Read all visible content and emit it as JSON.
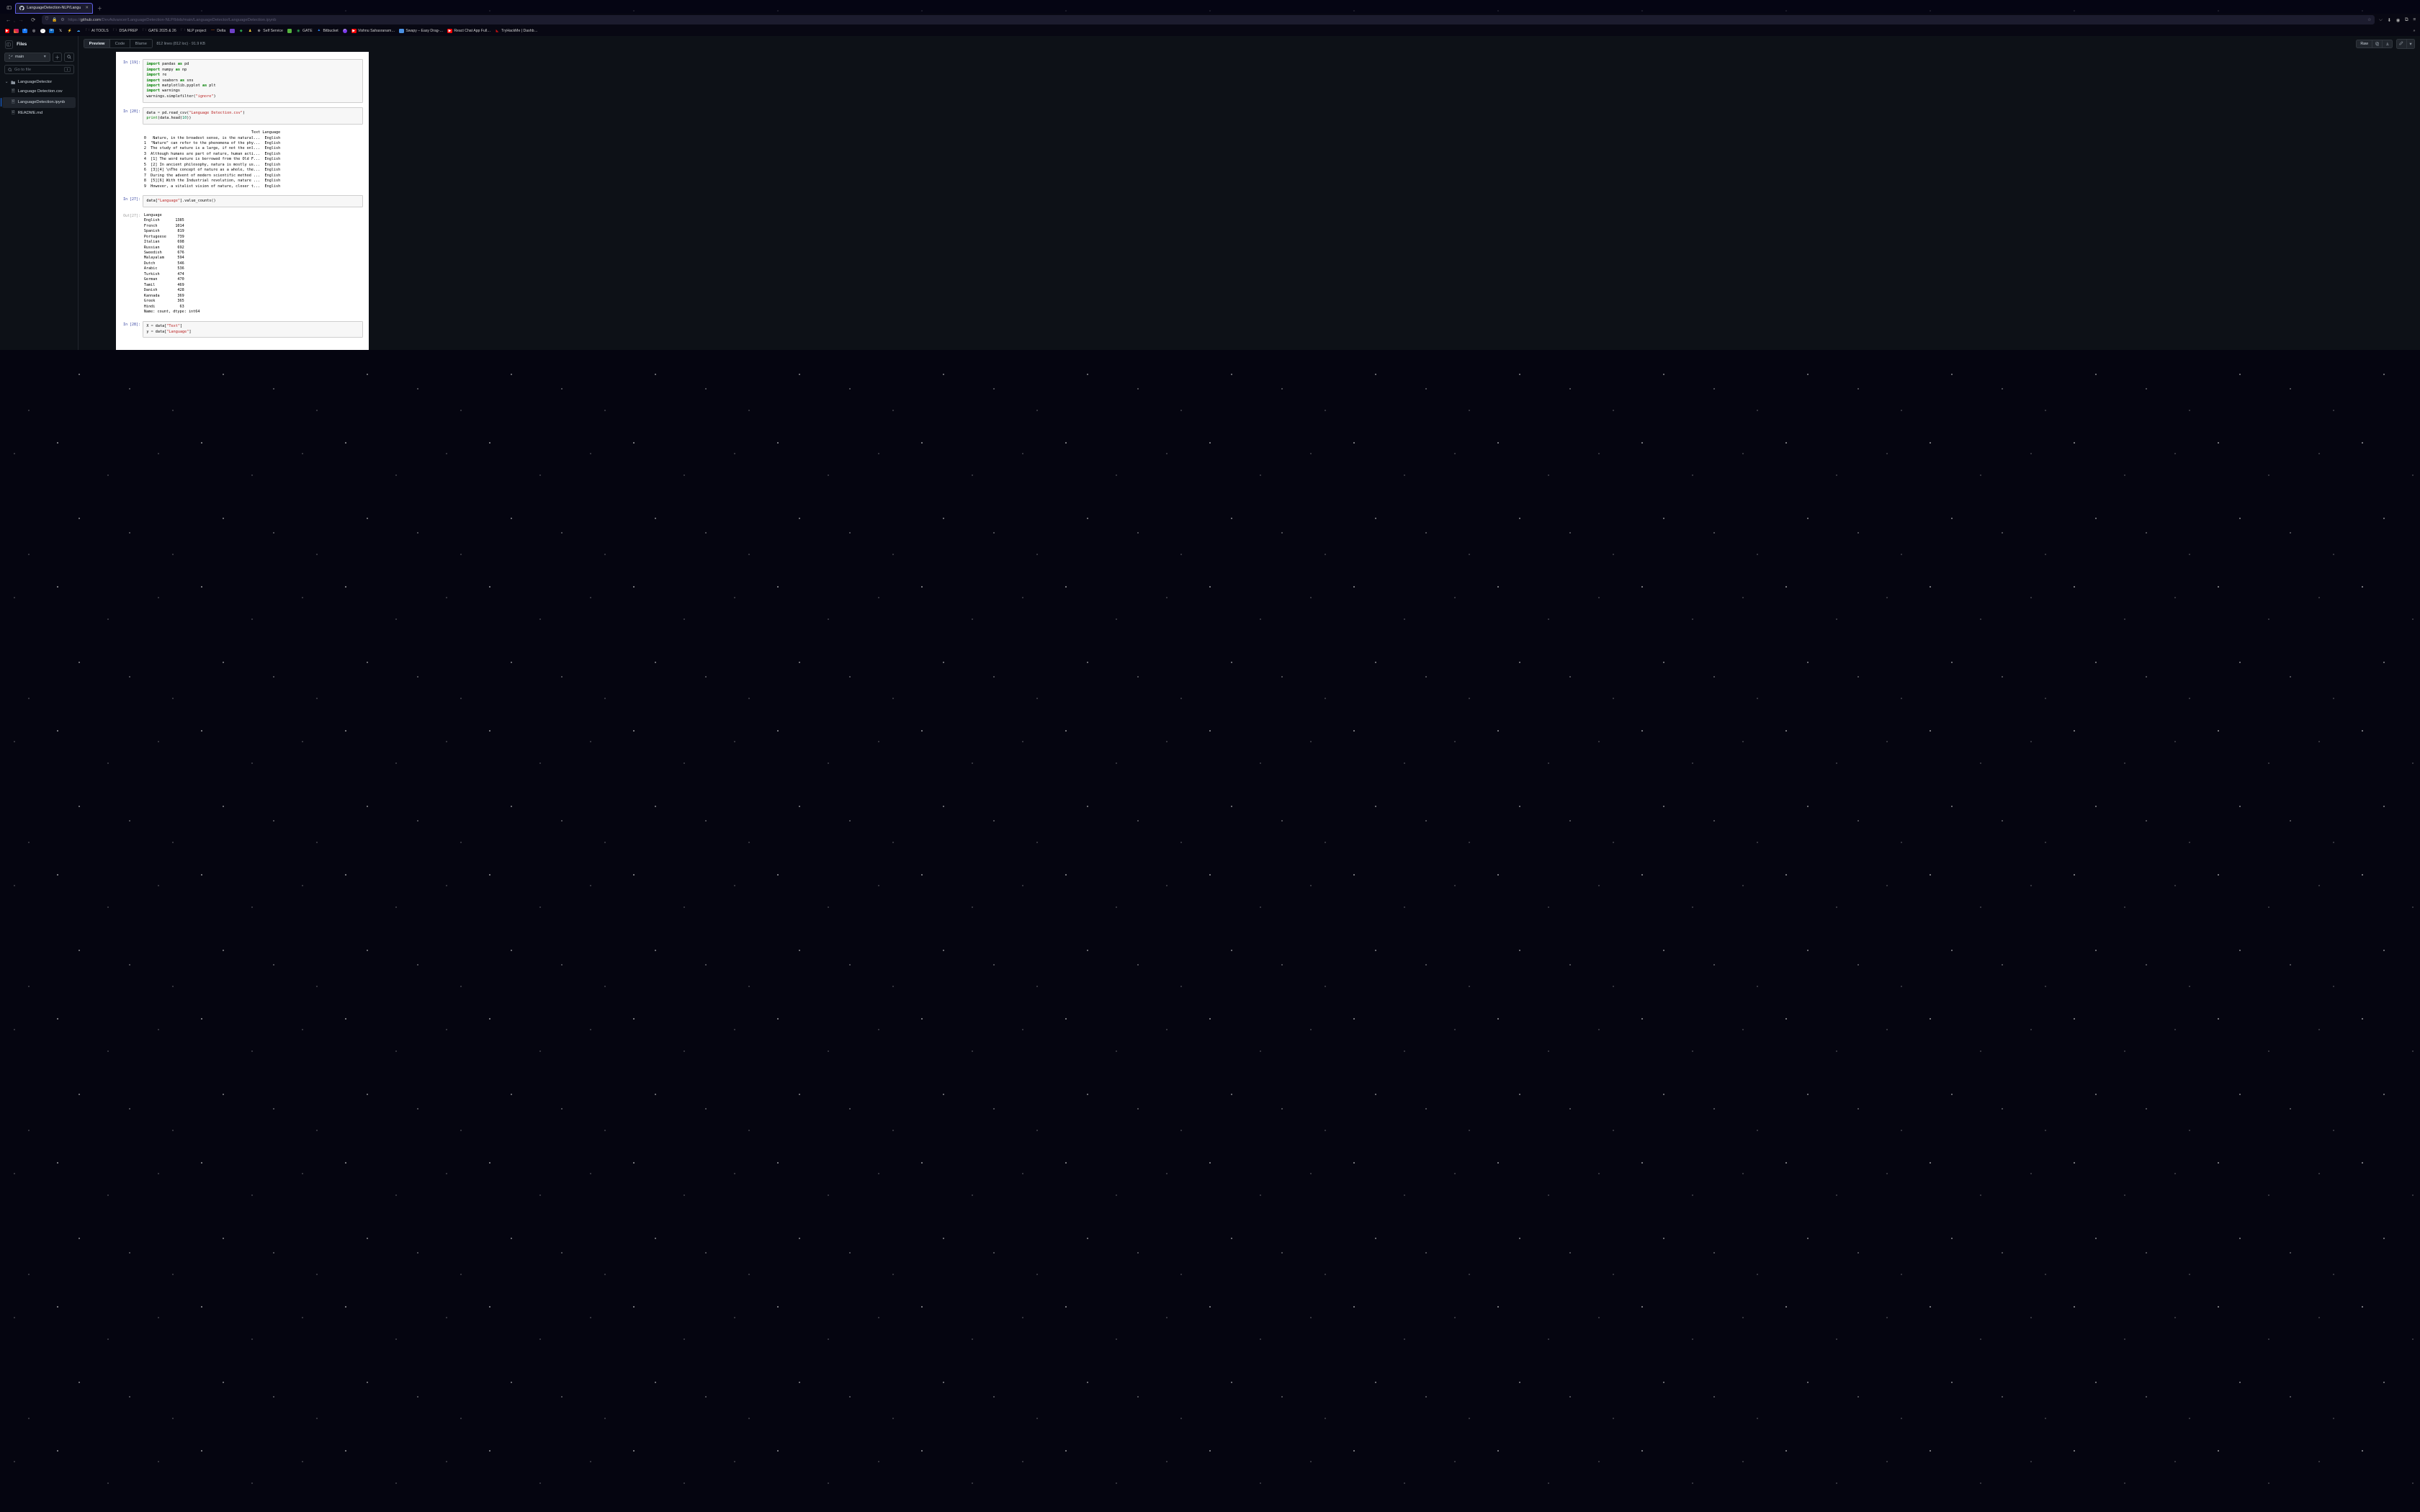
{
  "browser": {
    "tab_title": "LanguageDetection-NLP/Langu",
    "url_prefix": "https://",
    "url_host": "github.com",
    "url_path": "/DevAdvancer/LanguageDetection-NLP/blob/main/LanguageDetector/LanguageDetection.ipynb",
    "bookmarks": [
      {
        "label": "",
        "color": "#ff0000"
      },
      {
        "label": "",
        "color": "#e1306c"
      },
      {
        "label": "",
        "color": "#1877f2"
      },
      {
        "label": "",
        "color": "#000"
      },
      {
        "label": "",
        "color": "#24292f"
      },
      {
        "label": "",
        "color": "#0a66c2"
      },
      {
        "label": "",
        "color": "#000"
      },
      {
        "label": "",
        "color": "#f7b500"
      },
      {
        "label": "",
        "color": "#3ea6ff"
      },
      {
        "label": "AI TOOLS",
        "folder": true
      },
      {
        "label": "DSA PREP",
        "folder": true
      },
      {
        "label": "GATE 2025 & 26",
        "folder": true
      },
      {
        "label": "NLP project",
        "folder": true
      },
      {
        "label": "Delta",
        "color": "#ff7b00"
      },
      {
        "label": "",
        "color": "#6e40c9"
      },
      {
        "label": "",
        "color": "#2ea44f"
      },
      {
        "label": "",
        "color": "#ffd33d"
      },
      {
        "label": "Self Service",
        "color": "#888"
      },
      {
        "label": "",
        "color": "#54b33e"
      },
      {
        "label": "GATE",
        "color": "#2ea44f"
      },
      {
        "label": "Bitbucket",
        "color": "#2684ff"
      },
      {
        "label": "",
        "color": "#7c3aed"
      },
      {
        "label": "Vishnu Sahasranam…",
        "color": "#ff0000"
      },
      {
        "label": "Swapy – Easy Drag-…",
        "color": "#4a90e2"
      },
      {
        "label": "React Chat App Full…",
        "color": "#ff0000"
      },
      {
        "label": "TryHackMe | Dashb…",
        "color": "#c11"
      }
    ]
  },
  "sidebar": {
    "title": "Files",
    "branch": "main",
    "filter_placeholder": "Go to file",
    "kbd": "t",
    "folder": "LanguageDetector",
    "files": [
      {
        "name": "Language Detection.csv",
        "selected": false
      },
      {
        "name": "LanguageDetection.ipynb",
        "selected": true
      },
      {
        "name": "README.md",
        "selected": false
      }
    ]
  },
  "toolbar": {
    "preview": "Preview",
    "code": "Code",
    "blame": "Blame",
    "meta": "812 lines (812 loc) · 91.9 KB",
    "raw": "Raw"
  },
  "notebook": {
    "cells": [
      {
        "type": "in",
        "n": "19"
      },
      {
        "type": "in",
        "n": "20"
      },
      {
        "type": "stdout"
      },
      {
        "type": "in",
        "n": "27"
      },
      {
        "type": "out",
        "n": "27"
      },
      {
        "type": "in",
        "n": "28"
      }
    ],
    "c19": {
      "l1a": "import",
      "l1b": " pandas ",
      "l1c": "as",
      "l1d": " pd",
      "l2a": "import",
      "l2b": " numpy ",
      "l2c": "as",
      "l2d": " np",
      "l3a": "import",
      "l3b": " re",
      "l4a": "import",
      "l4b": " seaborn ",
      "l4c": "as",
      "l4d": " sns",
      "l5a": "import",
      "l5b": " matplotlib.pyplot ",
      "l5c": "as",
      "l5d": " plt",
      "l6a": "import",
      "l6b": " warnings",
      "l7a": "warnings.simplefilter(",
      "l7b": "\"ignore\"",
      "l7c": ")"
    },
    "c20": {
      "l1a": "data ",
      "l1b": "=",
      "l1c": " pd.read_csv(",
      "l1d": "\"Language Detection.csv\"",
      "l1e": ")",
      "l2a": "print",
      "l2b": "(data.head(",
      "l2c": "10",
      "l2d": "))"
    },
    "out20": "                                                Text Language\n0   Nature, in the broadest sense, is the natural...  English\n1  \"Nature\" can refer to the phenomena of the phy...  English\n2  The study of nature is a large, if not the onl...  English\n3  Although humans are part of nature, human acti...  English\n4  [1] The word nature is borrowed from the Old F...  English\n5  [2] In ancient philosophy, natura is mostly us...  English\n6  [3][4] \\nThe concept of nature as a whole, the...  English\n7  During the advent of modern scientific method ...  English\n8  [5][6] With the Industrial revolution, nature ...  English\n9  However, a vitalist vision of nature, closer t...  English",
    "c27": {
      "l1a": "data[",
      "l1b": "\"Language\"",
      "l1c": "].value_counts()"
    },
    "out27": "Language\nEnglish       1385\nFrench        1014\nSpanish        819\nPortugeese     739\nItalian        698\nRussian        692\nSweedish       676\nMalayalam      594\nDutch          546\nArabic         536\nTurkish        474\nGerman         470\nTamil          469\nDanish         428\nKannada        369\nGreek          365\nHindi           63\nName: count, dtype: int64",
    "c28": {
      "l1a": "X ",
      "l1b": "=",
      "l1c": " data[",
      "l1d": "\"Text\"",
      "l1e": "]",
      "l2a": "y ",
      "l2b": "=",
      "l2c": " data[",
      "l2d": "\"Language\"",
      "l2e": "]"
    }
  }
}
